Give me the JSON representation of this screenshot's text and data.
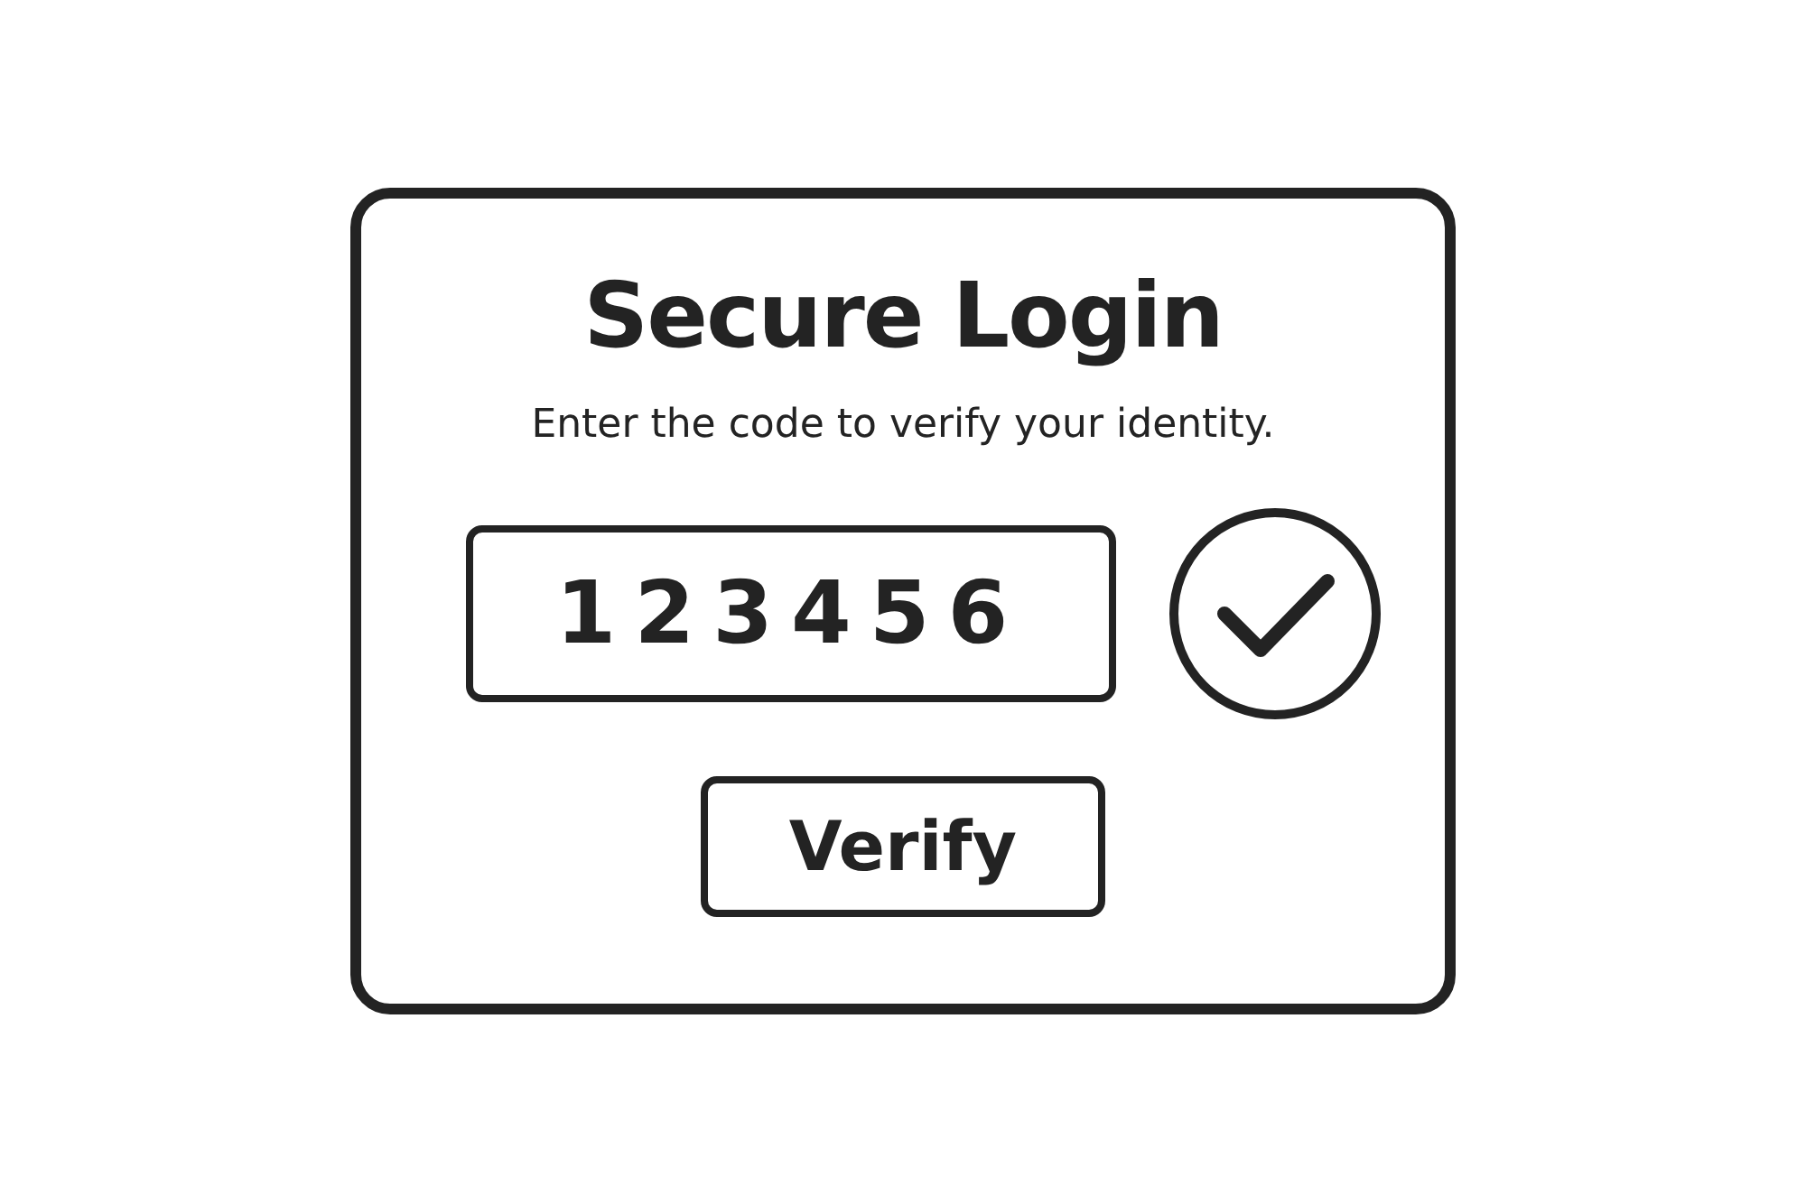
{
  "dialog": {
    "title": "Secure Login",
    "message": "Enter the code to verify your identity.",
    "code_field": {
      "value": "123456"
    },
    "verified": true,
    "button": "Verify"
  }
}
